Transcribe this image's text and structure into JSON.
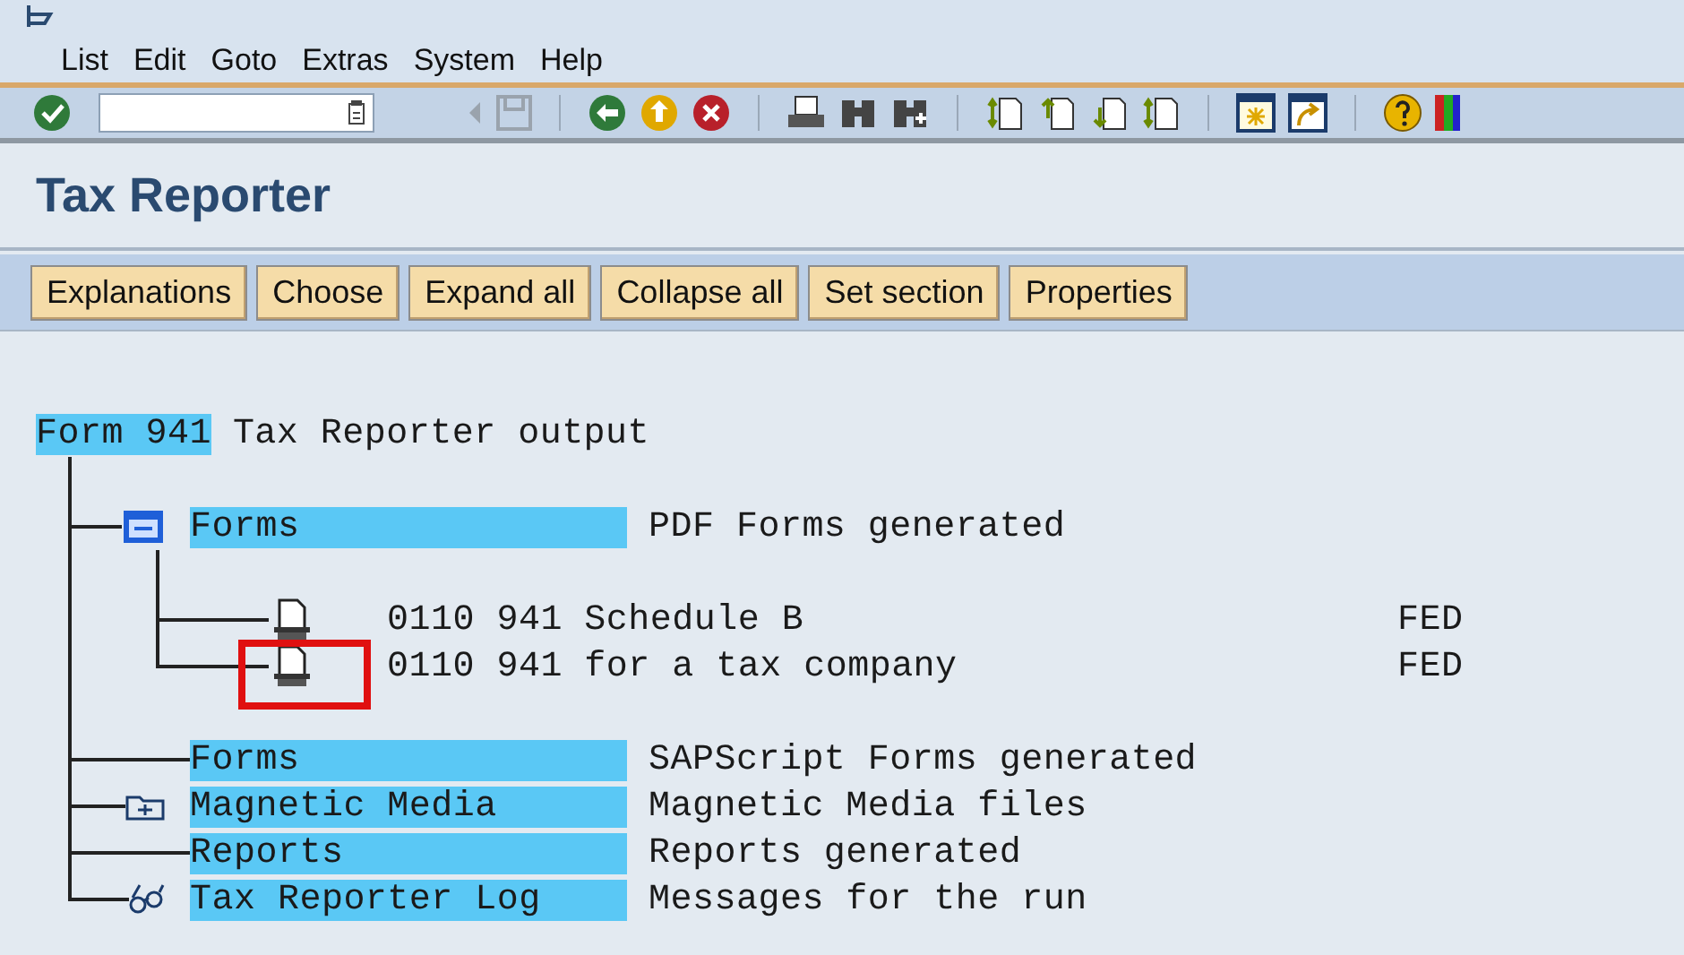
{
  "menu": [
    "List",
    "Edit",
    "Goto",
    "Extras",
    "System",
    "Help"
  ],
  "title": "Tax Reporter",
  "buttons": [
    "Explanations",
    "Choose",
    "Expand all",
    "Collapse all",
    "Set section",
    "Properties"
  ],
  "tree": {
    "label": "Form 941",
    "description": "Tax Reporter output",
    "highlighted": true,
    "children": [
      {
        "kind": "folder",
        "expanded": true,
        "label": "Forms",
        "description": "PDF Forms generated",
        "highlighted": true,
        "children": [
          {
            "kind": "document",
            "label": "0110 941 Schedule B",
            "description": "FED",
            "highlighted": false,
            "marked": false
          },
          {
            "kind": "document",
            "label": "0110 941 for a tax company",
            "description": "FED",
            "highlighted": false,
            "marked": true
          }
        ]
      },
      {
        "kind": "item",
        "label": "Forms",
        "description": "SAPScript Forms generated",
        "highlighted": true
      },
      {
        "kind": "folder",
        "expanded": false,
        "label": "Magnetic Media",
        "description": "Magnetic Media files",
        "highlighted": true
      },
      {
        "kind": "item",
        "label": "Reports",
        "description": "Reports generated",
        "highlighted": true
      },
      {
        "kind": "log",
        "label": "Tax Reporter Log",
        "description": "Messages for the run",
        "highlighted": true
      }
    ]
  }
}
